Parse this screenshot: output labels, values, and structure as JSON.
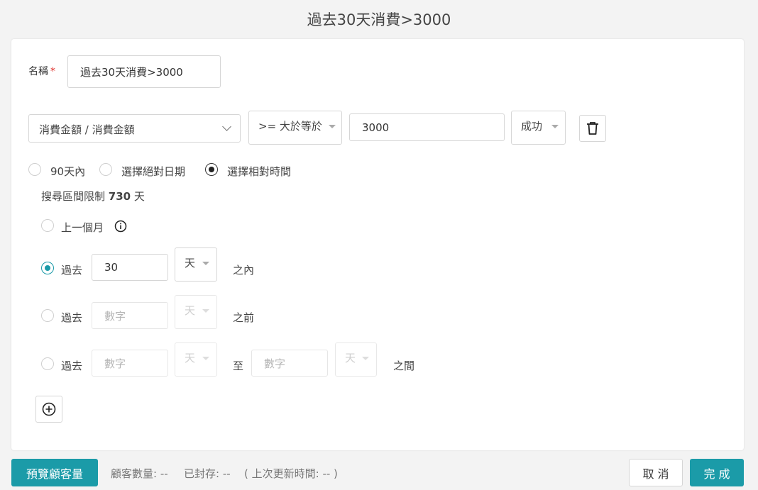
{
  "page": {
    "title": "過去30天消費>3000"
  },
  "form": {
    "name_label": "名稱",
    "required_mark": "*",
    "name_value": "過去30天消費>3000"
  },
  "condition": {
    "field_select": "消費金額 / 消費金額",
    "operator_select": ">= 大於等於",
    "value": "3000",
    "status_select": "成功",
    "delete_icon": "trash-icon"
  },
  "date_mode": {
    "options": [
      "90天內",
      "選擇絕對日期",
      "選擇相對時間"
    ],
    "selected": "選擇相對時間",
    "limit_prefix": "搜尋區間限制",
    "limit_value": "730",
    "limit_suffix": "天"
  },
  "relative": {
    "last_month_label": "上一個月",
    "info_icon": "info-icon",
    "within": {
      "prefix": "過去",
      "value": "30",
      "unit": "天",
      "suffix": "之內",
      "selected": true
    },
    "before": {
      "prefix": "過去",
      "placeholder": "數字",
      "unit": "天",
      "suffix": "之前"
    },
    "between": {
      "prefix": "過去",
      "from_placeholder": "數字",
      "from_unit": "天",
      "to_label": "至",
      "to_placeholder": "數字",
      "to_unit": "天",
      "suffix": "之間"
    }
  },
  "add_icon": "plus-circle-icon",
  "footer": {
    "preview_button": "預覽顧客量",
    "customer_count": "顧客數量:  --",
    "archived": "已封存:  --",
    "last_update": "(  上次更新時間:  --  )",
    "cancel_button": "取 消",
    "done_button": "完 成"
  },
  "colors": {
    "accent": "#1b9ba8",
    "required": "#e0342f",
    "background": "#f3f3f3"
  }
}
